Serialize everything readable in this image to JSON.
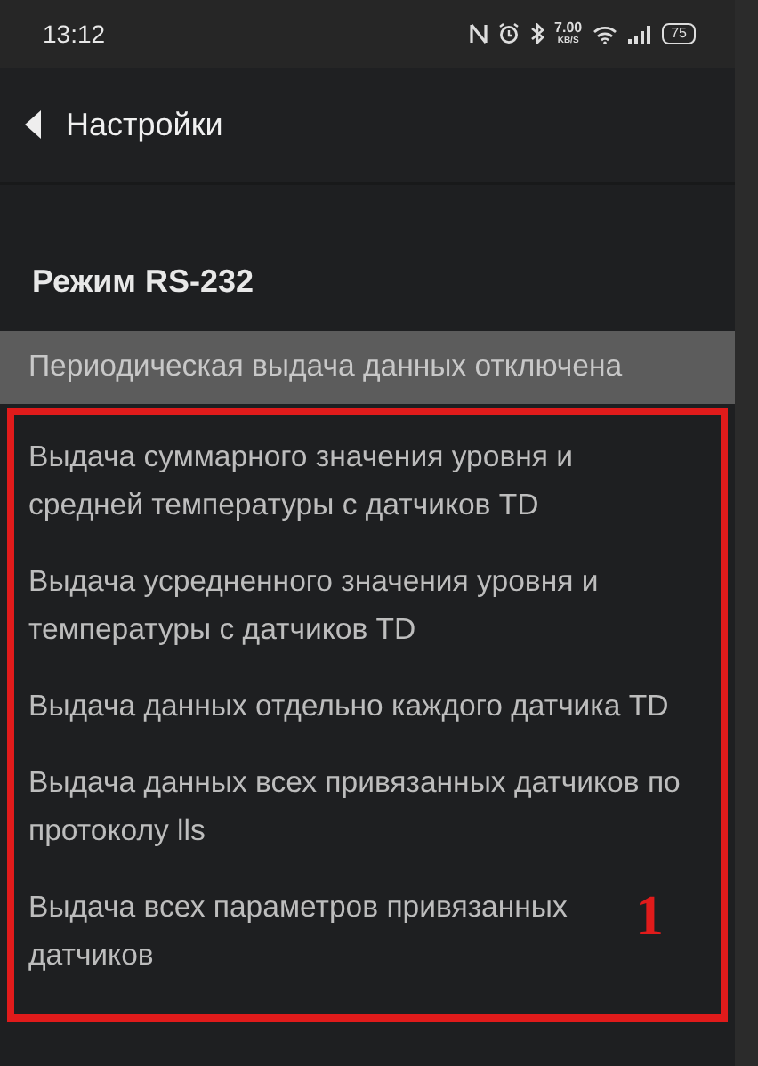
{
  "status_bar": {
    "time": "13:12",
    "speed": "7.00",
    "speed_unit": "KB/S",
    "battery": "75"
  },
  "header": {
    "title": "Настройки"
  },
  "section": {
    "title": "Режим RS-232"
  },
  "options": [
    {
      "label": "Периодическая выдача данных отключена",
      "selected": true,
      "framed": false
    },
    {
      "label": "Выдача суммарного значения уровня и средней температуры с датчиков TD",
      "selected": false,
      "framed": true
    },
    {
      "label": "Выдача усредненного значения уровня и температуры с датчиков TD",
      "selected": false,
      "framed": true
    },
    {
      "label": "Выдача данных отдельно каждого датчика TD",
      "selected": false,
      "framed": true
    },
    {
      "label": "Выдача данных всех привязанных датчиков по протоколу lls",
      "selected": false,
      "framed": true
    },
    {
      "label": "Выдача всех параметров привязанных датчиков",
      "selected": false,
      "framed": true
    }
  ],
  "annotation": {
    "label": "1"
  }
}
